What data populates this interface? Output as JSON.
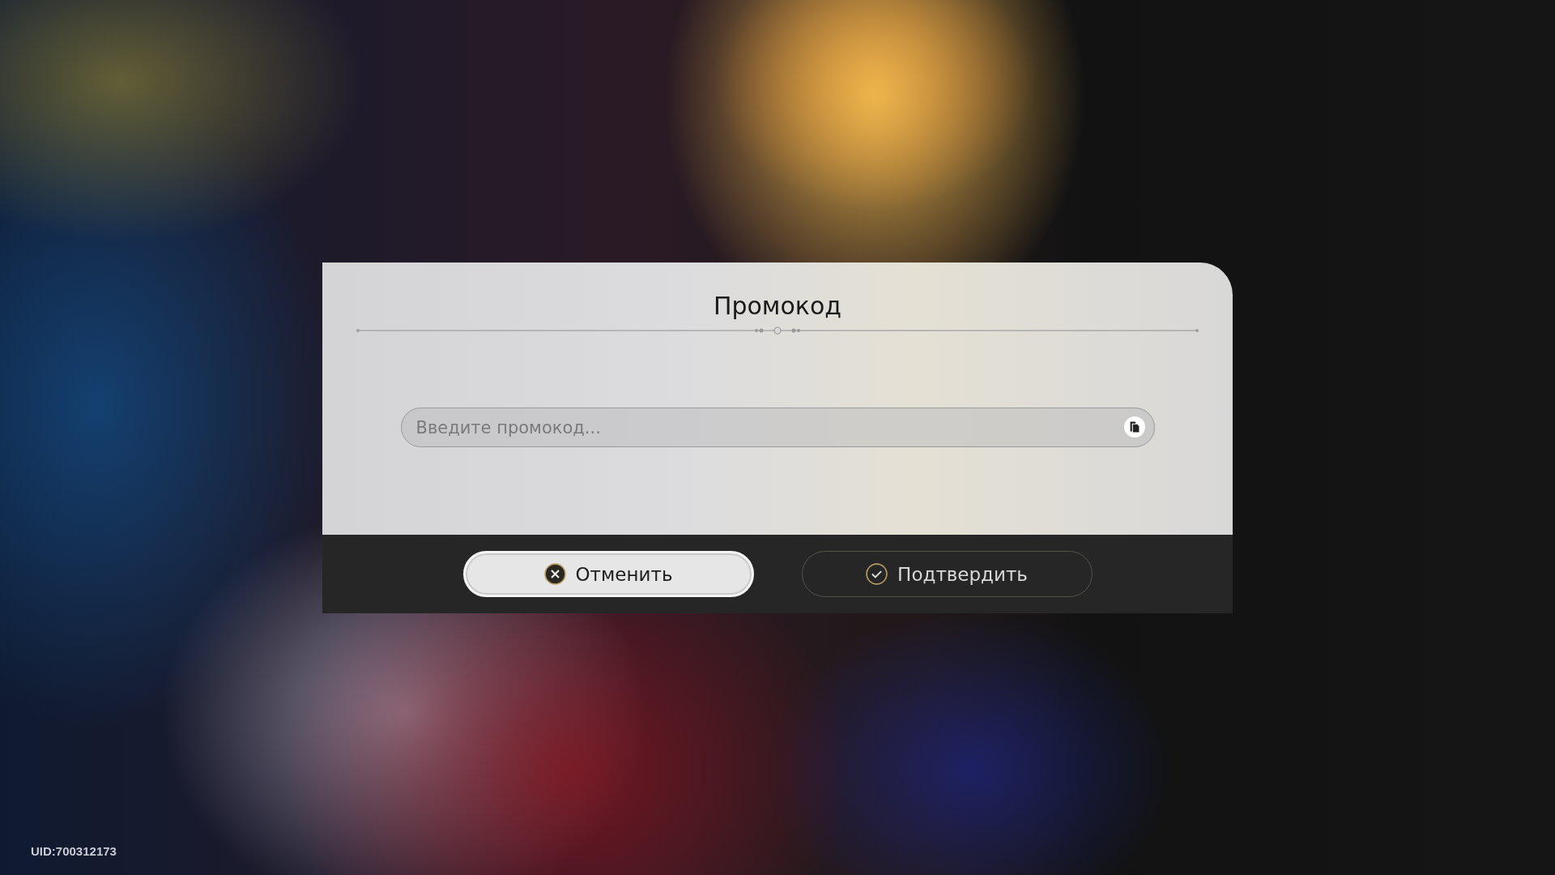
{
  "dialog": {
    "title": "Промокод",
    "input": {
      "placeholder": "Введите промокод..."
    },
    "buttons": [
      {
        "kind": "cancel",
        "label": "Отменить",
        "selected": true
      },
      {
        "kind": "confirm",
        "label": "Подтвердить",
        "selected": false
      }
    ]
  },
  "uid": "UID:700312173"
}
